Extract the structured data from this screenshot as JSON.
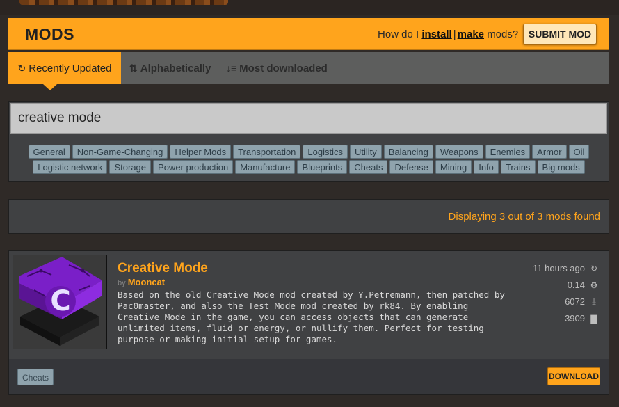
{
  "header": {
    "title": "MODS",
    "howto_prefix": "How do I",
    "install_link": "install",
    "separator": "|",
    "make_link": "make",
    "howto_suffix": "mods?",
    "submit_label": "SUBMIT MOD"
  },
  "sort_tabs": [
    {
      "label": "Recently Updated",
      "icon": "history-icon",
      "active": true
    },
    {
      "label": "Alphabetically",
      "icon": "sort-alpha-icon",
      "active": false
    },
    {
      "label": "Most downloaded",
      "icon": "sort-amount-icon",
      "active": false
    }
  ],
  "search": {
    "value": "creative mode"
  },
  "tags_row1": [
    "General",
    "Non-Game-Changing",
    "Helper Mods",
    "Transportation",
    "Logistics",
    "Utility",
    "Balancing",
    "Weapons",
    "Enemies",
    "Armor",
    "Oil"
  ],
  "tags_row2": [
    "Logistic network",
    "Storage",
    "Power production",
    "Manufacture",
    "Blueprints",
    "Cheats",
    "Defense",
    "Mining",
    "Info",
    "Trains",
    "Big mods"
  ],
  "results": {
    "text": "Displaying 3 out of 3 mods found"
  },
  "mod": {
    "title": "Creative Mode",
    "by": "by",
    "author": "Mooncat",
    "description": "Based on the old Creative Mode mod created by Y.Petremann, then patched by Pac0master, and also the Test Mode mod created by rk84. By enabling Creative Mode in the game, you can access objects that can generate unlimited items, fluid or energy, or nullify them. Perfect for testing purpose or making initial setup for games.",
    "updated": "11 hours ago",
    "version": "0.14",
    "downloads": "6072",
    "views": "3909",
    "category_tag": "Cheats",
    "download_label": "DOWNLOAD",
    "thumb_letter": "C"
  },
  "colors": {
    "accent": "#ffa41c",
    "panel": "#404143",
    "tag_bg": "#8fa3ad"
  }
}
